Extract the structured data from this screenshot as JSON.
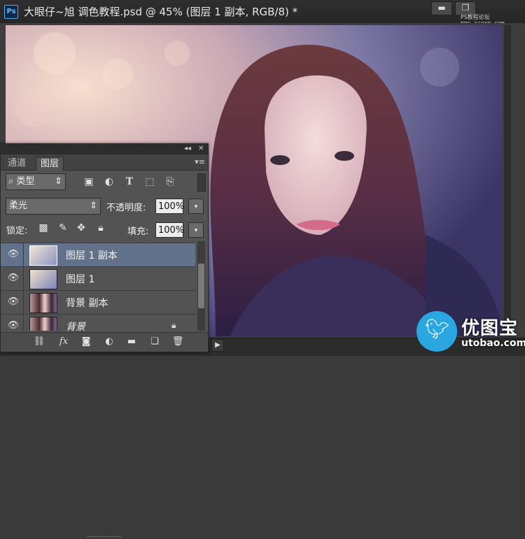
{
  "app": {
    "logo_text": "Ps",
    "document_title": "大眼仔~旭 调色教程.psd @ 45% (图层 1 副本, RGB/8) *",
    "window_buttons": {
      "minimize": "▬",
      "restore": "❐"
    },
    "watermark_top": [
      "PS教程论坛",
      "BBS.16XX8.COM"
    ]
  },
  "panel": {
    "collapse_label": "◂◂",
    "close_label": "✕",
    "tabs": [
      {
        "label": "通道",
        "active": false
      },
      {
        "label": "图层",
        "active": true
      }
    ],
    "tab_menu_label": "▾≡",
    "filter": {
      "icon": "search-icon",
      "label": "类型",
      "arrow": "⇕"
    },
    "filter_icons": [
      "image-icon",
      "adjustment-icon",
      "type-icon",
      "shape-icon",
      "smart-object-icon"
    ],
    "blend_mode": {
      "value": "柔光",
      "arrow": "⇕"
    },
    "opacity": {
      "label": "不透明度:",
      "value": "100%",
      "arrow": "▾"
    },
    "lock": {
      "label": "锁定:",
      "icons": [
        "lock-transparent-icon",
        "lock-paint-icon",
        "lock-move-icon",
        "lock-all-icon"
      ]
    },
    "fill": {
      "label": "填充:",
      "value": "100%",
      "arrow": "▾"
    },
    "layers": [
      {
        "name": "图层 1 副本",
        "selected": true,
        "visible": true,
        "thumb": "gradient",
        "locked": false
      },
      {
        "name": "图层 1",
        "selected": false,
        "visible": true,
        "thumb": "gradient",
        "locked": false
      },
      {
        "name": "背景 副本",
        "selected": false,
        "visible": true,
        "thumb": "photo",
        "locked": false
      },
      {
        "name": "背景",
        "selected": false,
        "visible": true,
        "thumb": "photo",
        "locked": true
      }
    ],
    "footer_icons": [
      "link-icon",
      "fx-icon",
      "mask-icon",
      "adjustment-layer-icon",
      "folder-icon",
      "new-layer-icon",
      "trash-icon"
    ]
  },
  "timeline": {
    "play_label": "▶"
  },
  "brand": {
    "name": "优图宝",
    "url": "utobao.com"
  },
  "colors": {
    "selected_layer": "#61728a",
    "panel_bg": "#535353",
    "brand_blue": "#2aa6e0"
  }
}
